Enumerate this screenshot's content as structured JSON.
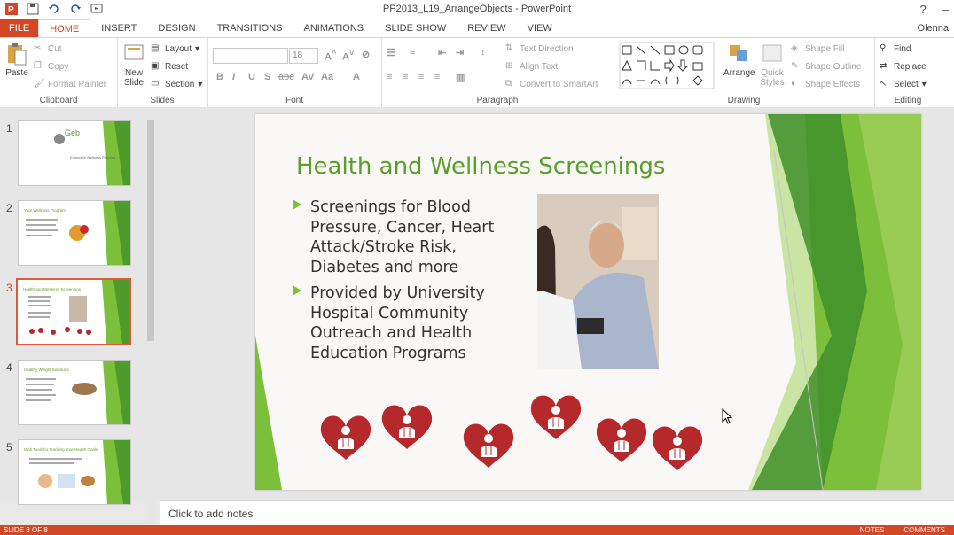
{
  "window": {
    "title": "PP2013_L19_ArrangeObjects - PowerPoint",
    "help": "?",
    "user": "Olenna"
  },
  "tabs": [
    "FILE",
    "HOME",
    "INSERT",
    "DESIGN",
    "TRANSITIONS",
    "ANIMATIONS",
    "SLIDE SHOW",
    "REVIEW",
    "VIEW"
  ],
  "ribbon": {
    "clipboard": {
      "label": "Clipboard",
      "paste": "Paste",
      "cut": "Cut",
      "copy": "Copy",
      "format_painter": "Format Painter"
    },
    "slides": {
      "label": "Slides",
      "new_slide": "New Slide",
      "layout": "Layout",
      "reset": "Reset",
      "section": "Section"
    },
    "font": {
      "label": "Font",
      "size": "18"
    },
    "paragraph": {
      "label": "Paragraph",
      "text_direction": "Text Direction",
      "align_text": "Align Text",
      "convert": "Convert to SmartArt"
    },
    "drawing": {
      "label": "Drawing",
      "arrange": "Arrange",
      "quick_styles": "Quick Styles",
      "shape_fill": "Shape Fill",
      "shape_outline": "Shape Outline",
      "shape_effects": "Shape Effects"
    },
    "editing": {
      "label": "Editing",
      "find": "Find",
      "replace": "Replace",
      "select": "Select"
    }
  },
  "thumbnails": [
    {
      "num": "1",
      "text_a": "Geb",
      "text_b": "Employee Wellness Program"
    },
    {
      "num": "2",
      "text_a": "Your Wellness Program"
    },
    {
      "num": "3",
      "text_a": "Health and Wellness Screenings"
    },
    {
      "num": "4",
      "text_a": "Healthy Weight Seminars"
    },
    {
      "num": "5",
      "text_a": "Web Tools for Tracking Your Health Goals"
    }
  ],
  "slide": {
    "title": "Health and Wellness Screenings",
    "bullets": [
      "Screenings for Blood Pressure, Cancer, Heart Attack/Stroke Risk, Diabetes and more",
      "Provided by University Hospital Community Outreach and Health Education Programs"
    ],
    "accent_color": "#7cbf3a",
    "heart_color": "#b5282b",
    "heart_count": 6
  },
  "notes": {
    "placeholder": "Click to add notes"
  },
  "status": {
    "slide_info": "SLIDE 3 OF 8",
    "notes_btn": "NOTES",
    "comments_btn": "COMMENTS"
  }
}
